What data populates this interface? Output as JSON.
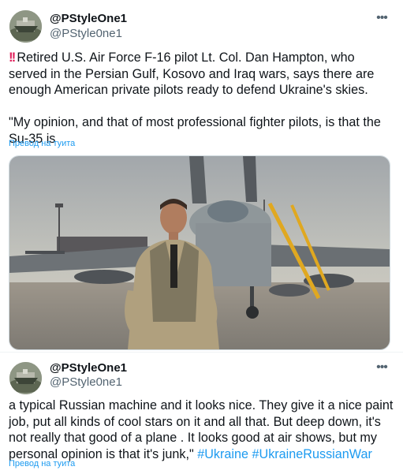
{
  "tweets": [
    {
      "author_name": "@PStyleOne1",
      "author_handle": "@PStyle0ne1",
      "text": "Retired U.S. Air Force F-16 pilot Lt. Col. Dan Hampton, who served in the Persian Gulf, Kosovo and Iraq wars, says there are enough American private pilots ready to defend Ukraine's skies.\n\n\"My opinion, and that of most professional fighter pilots, is that the Su-35 is",
      "alert_icon": "double-exclamation-icon",
      "translate_label": "Превод на туита",
      "media_alt": "photo"
    },
    {
      "author_name": "@PStyleOne1",
      "author_handle": "@PStyle0ne1",
      "text": "a typical Russian machine and it looks nice. They give it a nice paint job, put all kinds of cool stars on it and all that. But deep down, it's not really that good of a plane . It looks good at air shows, but my personal opinion is that it's junk,\" ",
      "hashtags": [
        "#Ukraine",
        "#UkraineRussianWar"
      ],
      "translate_label": "Превод на туита"
    }
  ],
  "more_icon": "more-options-icon",
  "colors": {
    "link": "#1d9bf0",
    "muted": "#536471",
    "text": "#0f1419",
    "alert": "#e0245e"
  }
}
